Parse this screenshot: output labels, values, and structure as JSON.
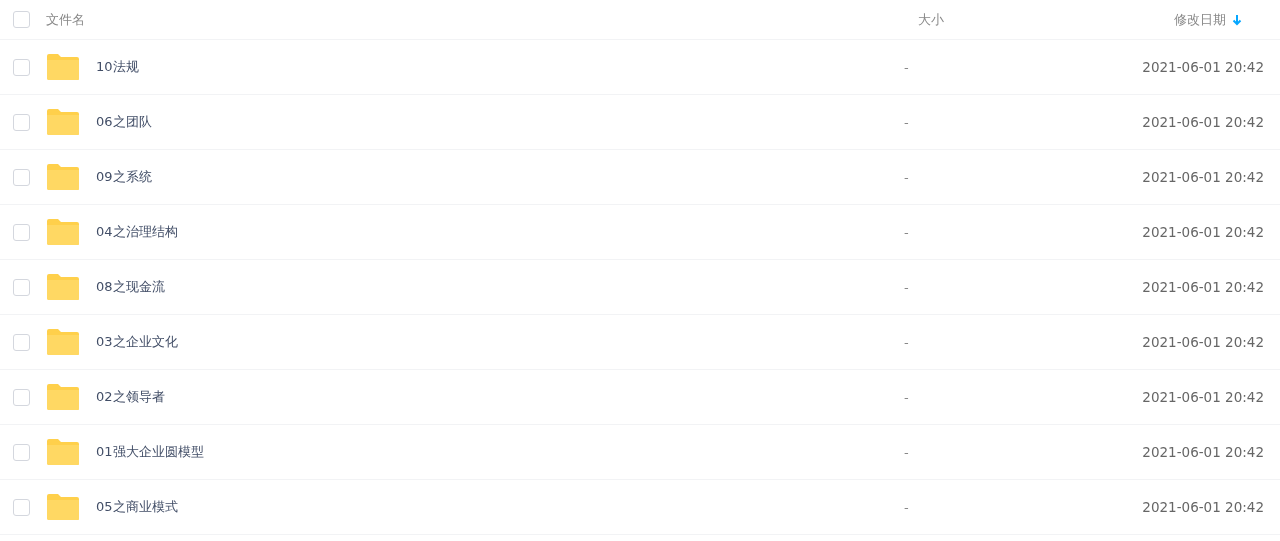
{
  "header": {
    "checked": false,
    "columns": [
      "文件名",
      "大小",
      "修改日期"
    ],
    "sort_descending": true
  },
  "rows": [
    {
      "name": "10法规",
      "size": "-",
      "modified": "2021-06-01 20:42",
      "checked": false
    },
    {
      "name": "06之团队",
      "size": "-",
      "modified": "2021-06-01 20:42",
      "checked": false
    },
    {
      "name": "09之系统",
      "size": "-",
      "modified": "2021-06-01 20:42",
      "checked": false
    },
    {
      "name": "04之治理结构",
      "size": "-",
      "modified": "2021-06-01 20:42",
      "checked": false
    },
    {
      "name": "08之现金流",
      "size": "-",
      "modified": "2021-06-01 20:42",
      "checked": false
    },
    {
      "name": "03之企业文化",
      "size": "-",
      "modified": "2021-06-01 20:42",
      "checked": false
    },
    {
      "name": "02之领导者",
      "size": "-",
      "modified": "2021-06-01 20:42",
      "checked": false
    },
    {
      "name": "01强大企业圆模型",
      "size": "-",
      "modified": "2021-06-01 20:42",
      "checked": false
    },
    {
      "name": "05之商业模式",
      "size": "-",
      "modified": "2021-06-01 20:42",
      "checked": false
    }
  ]
}
